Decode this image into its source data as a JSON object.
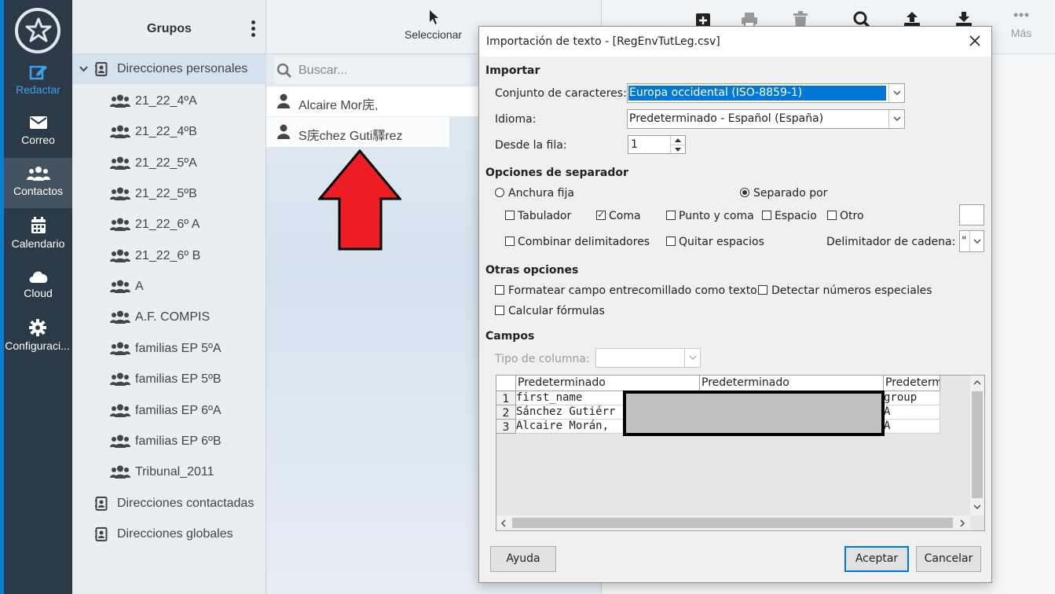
{
  "nav": {
    "logo_icon": "star-logo-icon",
    "items": [
      {
        "label": "Redactar",
        "icon": "compose-icon"
      },
      {
        "label": "Correo",
        "icon": "mail-icon"
      },
      {
        "label": "Contactos",
        "icon": "contacts-icon"
      },
      {
        "label": "Calendario",
        "icon": "calendar-icon"
      },
      {
        "label": "Cloud",
        "icon": "cloud-icon"
      },
      {
        "label": "Configuraci..."
      }
    ]
  },
  "groups": {
    "title": "Grupos",
    "address_books": [
      {
        "label": "Direcciones personales"
      },
      {
        "label": "Direcciones contactadas"
      },
      {
        "label": "Direcciones globales"
      }
    ],
    "items": [
      {
        "label": "21_22_4ºA"
      },
      {
        "label": "21_22_4ºB"
      },
      {
        "label": "21_22_5ºA"
      },
      {
        "label": "21_22_5ºB"
      },
      {
        "label": "21_22_6º A"
      },
      {
        "label": "21_22_6º B"
      },
      {
        "label": "A"
      },
      {
        "label": "A.F. COMPIS"
      },
      {
        "label": "familias EP 5ºA"
      },
      {
        "label": "familias EP 5ºB"
      },
      {
        "label": "familias EP 6ºA"
      },
      {
        "label": "familias EP 6ºB"
      },
      {
        "label": "Tribunal_2011"
      }
    ]
  },
  "contacts": {
    "select_label": "Seleccionar",
    "search_placeholder": "Buscar...",
    "items": [
      {
        "name": "Alcaire Mor庑,"
      },
      {
        "name": "S庑chez Guti驛rez"
      }
    ]
  },
  "toolbar": {
    "more_label": "Más"
  },
  "colors": {
    "rail_bg": "#2c3a47",
    "accent": "#0b7fd6",
    "arrow": "#ee1c25",
    "selection": "#0078d7"
  },
  "dialog": {
    "title": "Importación de texto - [RegEnvTutLeg.csv]",
    "import_section": "Importar",
    "charset_label": "Conjunto de caracteres:",
    "charset_value": "Europa occidental (ISO-8859-1)",
    "language_label": "Idioma:",
    "language_value": "Predeterminado - Español (España)",
    "from_row_label": "Desde la fila:",
    "from_row_value": "1",
    "separator_section": "Opciones de separador",
    "fixed_width_label": "Anchura fija",
    "fixed_width_selected": false,
    "separated_by_label": "Separado por",
    "separated_by_selected": true,
    "tab_label": "Tabulador",
    "tab_checked": false,
    "comma_label": "Coma",
    "comma_checked": true,
    "semicolon_label": "Punto y coma",
    "semicolon_checked": false,
    "space_label": "Espacio",
    "space_checked": false,
    "other_label": "Otro",
    "other_checked": false,
    "other_value": "",
    "merge_label": "Combinar delimitadores",
    "merge_checked": false,
    "trim_label": "Quitar espacios",
    "trim_checked": false,
    "string_delim_label": "Delimitador de cadena:",
    "string_delim_value": "\"",
    "other_options_section": "Otras opciones",
    "quoted_as_text_label": "Formatear campo entrecomillado como texto",
    "quoted_as_text_checked": false,
    "special_numbers_label": "Detectar números especiales",
    "special_numbers_checked": false,
    "formulas_label": "Calcular fórmulas",
    "formulas_checked": false,
    "fields_section": "Campos",
    "column_type_label": "Tipo de columna:",
    "column_type_value": "",
    "grid": {
      "headers": [
        "Predeterminado",
        "Predeterminado",
        "Predeterm"
      ],
      "rows": [
        {
          "num": "1",
          "c1": "first_name",
          "c3": "group"
        },
        {
          "num": "2",
          "c1": "Sánchez Gutiérr",
          "c3": "A"
        },
        {
          "num": "3",
          "c1": "Alcaire Morán, ",
          "c3": "A"
        }
      ]
    },
    "help_label": "Ayuda",
    "ok_label": "Aceptar",
    "cancel_label": "Cancelar"
  }
}
